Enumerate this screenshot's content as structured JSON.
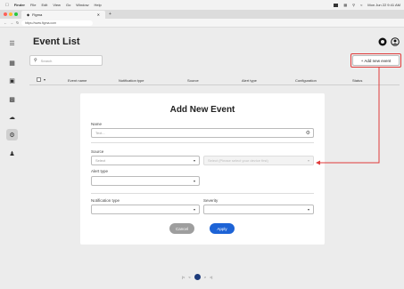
{
  "menubar": {
    "app": "Finder",
    "items": [
      "File",
      "Edit",
      "View",
      "Go",
      "Window",
      "Help"
    ],
    "clock": "Mon Jun 22 9:41 AM"
  },
  "browser": {
    "tab_title": "Figma",
    "url": "https://www.figma.com"
  },
  "page": {
    "title": "Event List",
    "search_placeholder": "Search",
    "add_button": "+ Add new event"
  },
  "table": {
    "columns": [
      "Event name",
      "Notification type",
      "Source",
      "Alert type",
      "Configuration",
      "Status"
    ]
  },
  "modal": {
    "title": "Add New Event",
    "name_label": "Name",
    "name_value": "Text...",
    "source_label": "Source",
    "source_placeholder": "Select",
    "source_detail_placeholder": "Select (Please select your device first)",
    "alert_type_label": "Alert type",
    "notification_type_label": "Notification type",
    "severity_label": "Severity",
    "cancel_label": "Cancel",
    "apply_label": "Apply"
  },
  "pagination": {
    "first": "|<",
    "prev": "<",
    "next": ">",
    "last": ">|"
  },
  "colors": {
    "accent": "#1d63d6",
    "highlight": "#e03a3a",
    "pagination_active": "#1d3b7a"
  }
}
